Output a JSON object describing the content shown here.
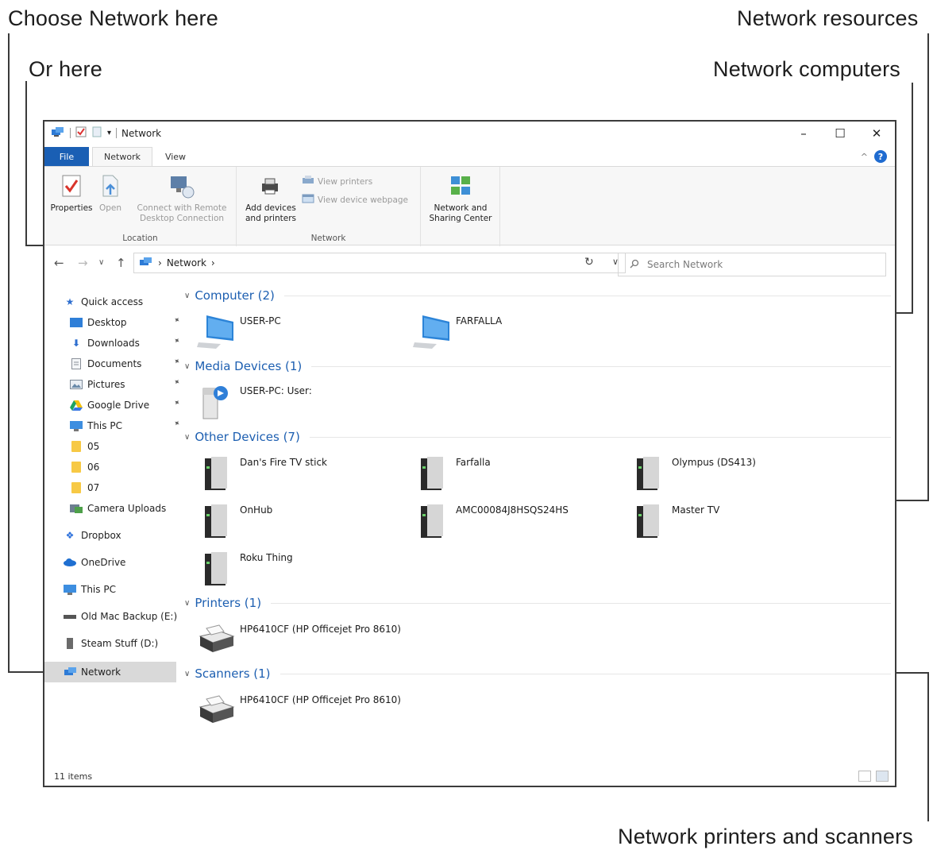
{
  "callouts": {
    "choose_network": "Choose Network here",
    "or_here": "Or here",
    "network_resources": "Network resources",
    "network_computers": "Network computers",
    "printers_scanners": "Network printers and scanners"
  },
  "window": {
    "title": "Network",
    "tabs": {
      "file": "File",
      "network": "Network",
      "view": "View"
    },
    "controls": {
      "minimize": "–",
      "maximize": "☐",
      "close": "✕"
    },
    "help": "?"
  },
  "ribbon": {
    "location_group": "Location",
    "network_group": "Network",
    "properties": "Properties",
    "open": "Open",
    "connect_remote_line1": "Connect with Remote",
    "connect_remote_line2": "Desktop Connection",
    "add_devices_line1": "Add devices",
    "add_devices_line2": "and printers",
    "view_printers": "View printers",
    "view_device_webpage": "View device webpage",
    "network_sharing_line1": "Network and",
    "network_sharing_line2": "Sharing Center"
  },
  "address": {
    "path": "Network",
    "separator": "›",
    "search_placeholder": "Search Network"
  },
  "sidebar": {
    "quick_access": "Quick access",
    "items": [
      {
        "label": "Desktop",
        "icon": "desktop-icon"
      },
      {
        "label": "Downloads",
        "icon": "download-arrow-icon"
      },
      {
        "label": "Documents",
        "icon": "document-icon"
      },
      {
        "label": "Pictures",
        "icon": "pictures-icon"
      },
      {
        "label": "Google Drive",
        "icon": "google-drive-icon"
      },
      {
        "label": "This PC",
        "icon": "monitor-icon"
      },
      {
        "label": "05",
        "icon": "folder-icon"
      },
      {
        "label": "06",
        "icon": "folder-icon"
      },
      {
        "label": "07",
        "icon": "folder-icon"
      },
      {
        "label": "Camera Uploads",
        "icon": "camera-uploads-icon"
      }
    ],
    "dropbox": "Dropbox",
    "onedrive": "OneDrive",
    "this_pc": "This PC",
    "old_mac_backup": "Old Mac Backup (E:)",
    "steam_stuff": "Steam Stuff (D:)",
    "network": "Network"
  },
  "groups": {
    "computer": "Computer (2)",
    "media": "Media Devices (1)",
    "other": "Other Devices (7)",
    "printers": "Printers (1)",
    "scanners": "Scanners (1)"
  },
  "computers": [
    "USER-PC",
    "FARFALLA"
  ],
  "media_devices": [
    "USER-PC: User:"
  ],
  "other_devices": [
    "Dan's Fire TV stick",
    "Farfalla",
    "Olympus (DS413)",
    "OnHub",
    "AMC00084J8HSQS24HS",
    "Master TV",
    "Roku Thing"
  ],
  "printers": [
    "HP6410CF (HP Officejet Pro 8610)"
  ],
  "scanners": [
    "HP6410CF (HP Officejet Pro 8610)"
  ],
  "status": {
    "count": "11 items"
  },
  "colors": {
    "accent": "#1a5fb4",
    "group_header": "#1d5fb1",
    "selected": "#d9d9d9"
  }
}
